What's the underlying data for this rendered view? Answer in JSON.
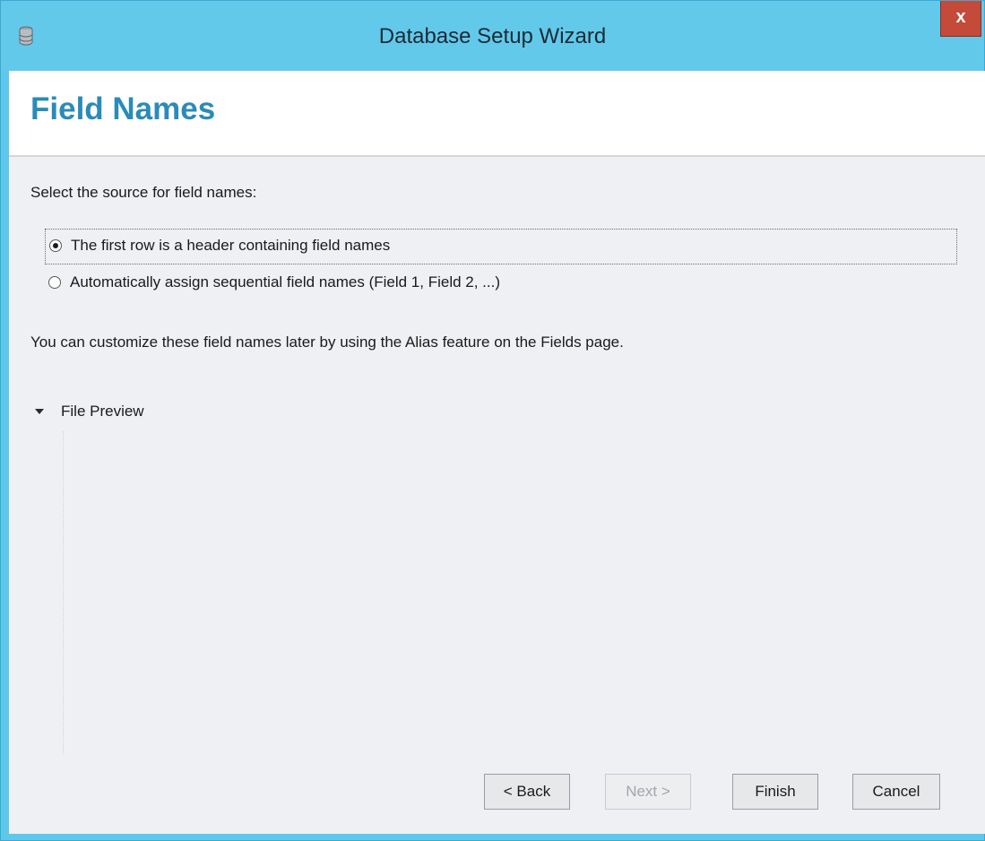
{
  "window": {
    "title": "Database Setup Wizard",
    "close_label": "x",
    "icon": "database-icon"
  },
  "header": {
    "title": "Field Names"
  },
  "main": {
    "prompt": "Select the source for field names:",
    "options": [
      {
        "label": "The first row is a header containing field names",
        "selected": true
      },
      {
        "label": "Automatically assign sequential field names (Field 1, Field 2, ...)",
        "selected": false
      }
    ],
    "note": "You can customize these field names later by using the Alias feature on the Fields page.",
    "preview": {
      "label": "File Preview",
      "icon": "chevron-down-icon",
      "expanded": true
    }
  },
  "footer": {
    "back_label": "< Back",
    "next_label": "Next >",
    "next_enabled": false,
    "finish_label": "Finish",
    "cancel_label": "Cancel"
  },
  "colors": {
    "titlebar": "#62c9eb",
    "title_text": "#2a8bb8",
    "close_button": "#c44a3a",
    "content_bg": "#eef0f3"
  }
}
